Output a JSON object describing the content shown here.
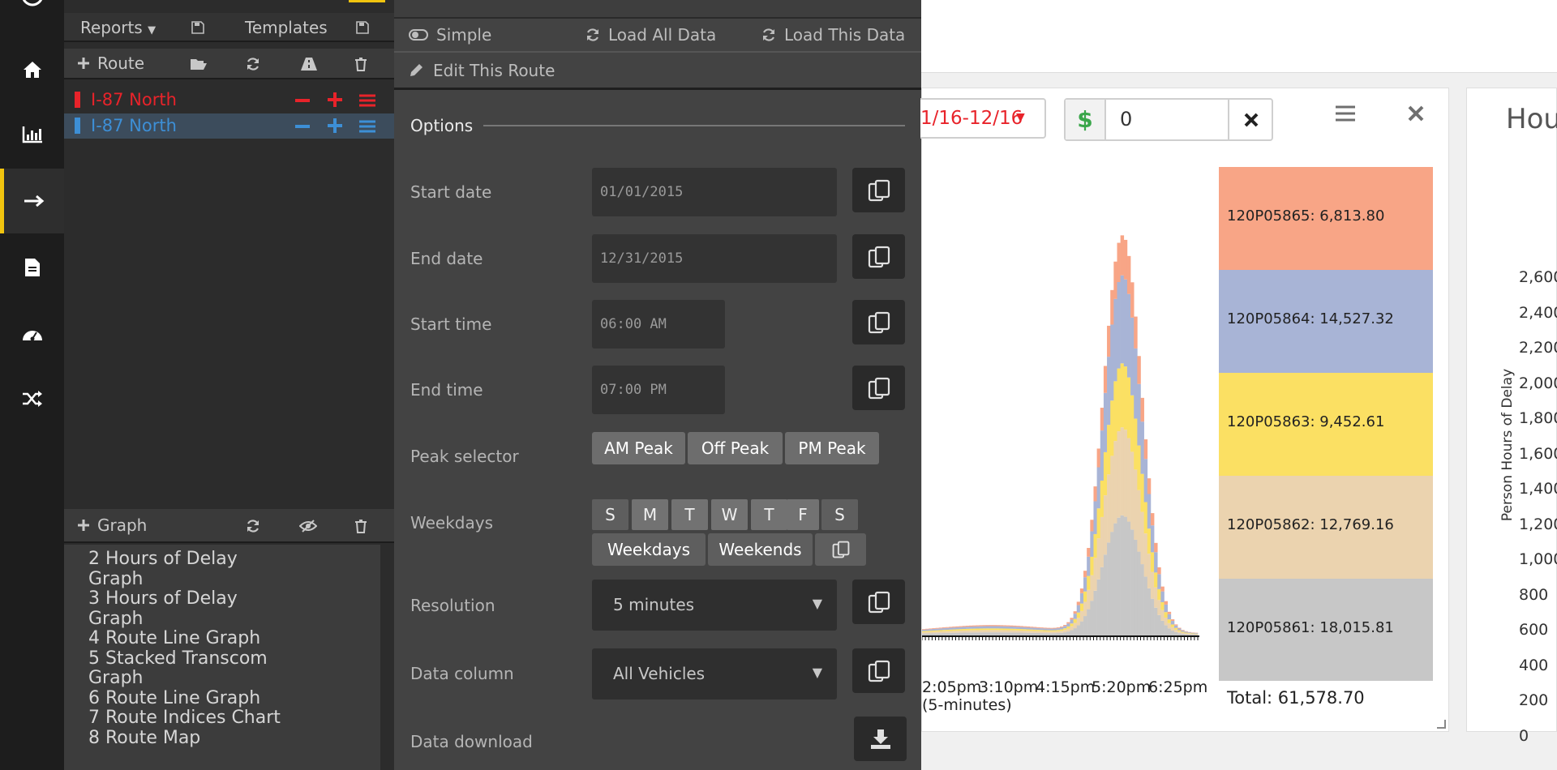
{
  "left_toolbar": {
    "reports_label": "Reports",
    "templates_label": "Templates"
  },
  "route_toolbar": {
    "route_label": "Route"
  },
  "routes": [
    {
      "name": "I-87 North",
      "color": "#e8232a"
    },
    {
      "name": "I-87 North",
      "color": "#3d8fd6"
    }
  ],
  "graph_toolbar": {
    "graph_label": "Graph"
  },
  "graphs": [
    "2 Hours of Delay Graph",
    "3 Hours of Delay Graph",
    "4 Route Line Graph",
    "5 Stacked Transcom Graph",
    "6 Route Line Graph",
    "7 Route Indices Chart",
    "8 Route Map"
  ],
  "options_header": {
    "simple_label": "Simple",
    "load_all_label": "Load All Data",
    "load_this_label": "Load This Data",
    "edit_route_label": "Edit This Route"
  },
  "options": {
    "title": "Options",
    "start_date_label": "Start date",
    "start_date": "01/01/2015",
    "end_date_label": "End date",
    "end_date": "12/31/2015",
    "start_time_label": "Start time",
    "start_time": "06:00 AM",
    "end_time_label": "End time",
    "end_time": "07:00 PM",
    "peak_label": "Peak selector",
    "peaks": [
      "AM Peak",
      "Off Peak",
      "PM Peak"
    ],
    "weekdays_label": "Weekdays",
    "days": [
      "S",
      "M",
      "T",
      "W",
      "T",
      "F",
      "S"
    ],
    "weekdays_button": "Weekdays",
    "weekends_button": "Weekends",
    "resolution_label": "Resolution",
    "resolution_value": "5 minutes",
    "data_column_label": "Data column",
    "data_column_value": "All Vehicles",
    "download_label": "Data download"
  },
  "chart_controls": {
    "date_range": "1/16-12/16",
    "currency_symbol": "$",
    "cost_value": "0"
  },
  "chart_data": {
    "type": "bar",
    "stacked": true,
    "x_tick_labels": [
      "2:05pm",
      "3:10pm",
      "4:15pm",
      "5:20pm",
      "6:25pm"
    ],
    "xlabel": "(5-minutes)",
    "series": [
      {
        "name": "120P05861",
        "color": "#c7c7c7",
        "total": "18,015.81"
      },
      {
        "name": "120P05862",
        "color": "#ebd3af",
        "total": "12,769.16"
      },
      {
        "name": "120P05863",
        "color": "#fbe063",
        "total": "9,452.61"
      },
      {
        "name": "120P05864",
        "color": "#a8b4d6",
        "total": "14,527.32"
      },
      {
        "name": "120P05865",
        "color": "#f8a586",
        "total": "6,813.80"
      }
    ],
    "legend_order": [
      {
        "label": "120P05865: 6,813.80",
        "color": "#f8a586"
      },
      {
        "label": "120P05864: 14,527.32",
        "color": "#a8b4d6"
      },
      {
        "label": "120P05863: 9,452.61",
        "color": "#fbe063"
      },
      {
        "label": "120P05862: 12,769.16",
        "color": "#ebd3af"
      },
      {
        "label": "120P05861: 18,015.81",
        "color": "#c7c7c7"
      }
    ],
    "total_label": "Total: 61,578.70"
  },
  "second_chart": {
    "title_partial": "Hou",
    "ylabel": "Person Hours of Delay",
    "y_ticks": [
      "2,600",
      "2,400",
      "2,200",
      "2,000",
      "1,800",
      "1,600",
      "1,400",
      "1,200",
      "1,000",
      "800",
      "600",
      "400",
      "200",
      "0"
    ]
  }
}
